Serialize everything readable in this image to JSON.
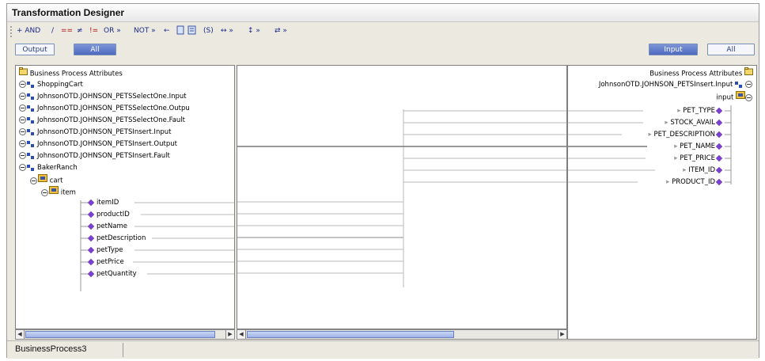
{
  "window": {
    "title": "Transformation Designer"
  },
  "toolbar": {
    "items": [
      "+ AND",
      "/",
      "==",
      "≠",
      "!=",
      "OR »",
      "NOT »",
      "←",
      "(S)",
      "↔ »",
      "↕ »",
      "⇄ »"
    ]
  },
  "left_tabs": {
    "output": "Output",
    "all": "All"
  },
  "right_tabs": {
    "input": "Input",
    "all": "All"
  },
  "left_tree": {
    "root": "Business Process Attributes",
    "items": [
      "ShoppingCart",
      "JohnsonOTD.JOHNSON_PETSSelectOne.Input",
      "JohnsonOTD.JOHNSON_PETSSelectOne.Outpu",
      "JohnsonOTD.JOHNSON_PETSSelectOne.Fault",
      "JohnsonOTD.JOHNSON_PETSInsert.Input",
      "JohnsonOTD.JOHNSON_PETSInsert.Output",
      "JohnsonOTD.JOHNSON_PETSInsert.Fault",
      "BakerRanch",
      "cart",
      "item"
    ],
    "leaves": [
      "itemID",
      "productID",
      "petName",
      "petDescription",
      "petType",
      "petPrice",
      "petQuantity"
    ]
  },
  "right_tree": {
    "root": "Business Process Attributes",
    "node": "JohnsonOTD.JOHNSON_PETSInsert.Input",
    "sub": "input",
    "fields": [
      "PET_TYPE",
      "STOCK_AVAIL",
      "PET_DESCRIPTION",
      "PET_NAME",
      "PET_PRICE",
      "ITEM_ID",
      "PRODUCT_ID"
    ]
  },
  "status": {
    "tab": "BusinessProcess3"
  },
  "colors": {
    "accent": "#4e6ac0",
    "diamond": "#7b3fd0",
    "node": "#2a4db8"
  }
}
